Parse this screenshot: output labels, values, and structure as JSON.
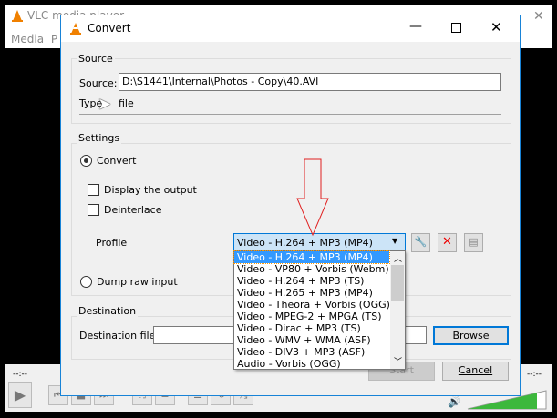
{
  "main_window": {
    "title": "VLC media player",
    "menu": [
      "Media",
      "P"
    ],
    "time_left": "--:--",
    "time_right": "--:--",
    "volume": "100%",
    "volume_level": 1.0
  },
  "dialog": {
    "title": "Convert",
    "source": {
      "group": "Source",
      "label": "Source:",
      "value": "D:\\S1441\\Internal\\Photos - Copy\\40.AVI",
      "type_label": "Type:",
      "type_value": "file"
    },
    "settings": {
      "group": "Settings",
      "convert": "Convert",
      "display_output": "Display the output",
      "deinterlace": "Deinterlace",
      "profile_label": "Profile",
      "profile_selected": "Video - H.264 + MP3 (MP4)",
      "dump_raw": "Dump raw input"
    },
    "profile_options": [
      "Video - H.264 + MP3 (MP4)",
      "Video - VP80 + Vorbis (Webm)",
      "Video - H.264 + MP3 (TS)",
      "Video - H.265 + MP3 (MP4)",
      "Video - Theora + Vorbis (OGG)",
      "Video - MPEG-2 + MPGA (TS)",
      "Video - Dirac + MP3 (TS)",
      "Video - WMV + WMA (ASF)",
      "Video - DIV3 + MP3 (ASF)",
      "Audio - Vorbis (OGG)"
    ],
    "destination": {
      "group": "Destination",
      "label": "Destination file:",
      "value": "",
      "browse": "Browse"
    },
    "start": "Start",
    "cancel": "Cancel"
  },
  "colors": {
    "accent": "#1883d7",
    "arrow": "#e02020"
  }
}
